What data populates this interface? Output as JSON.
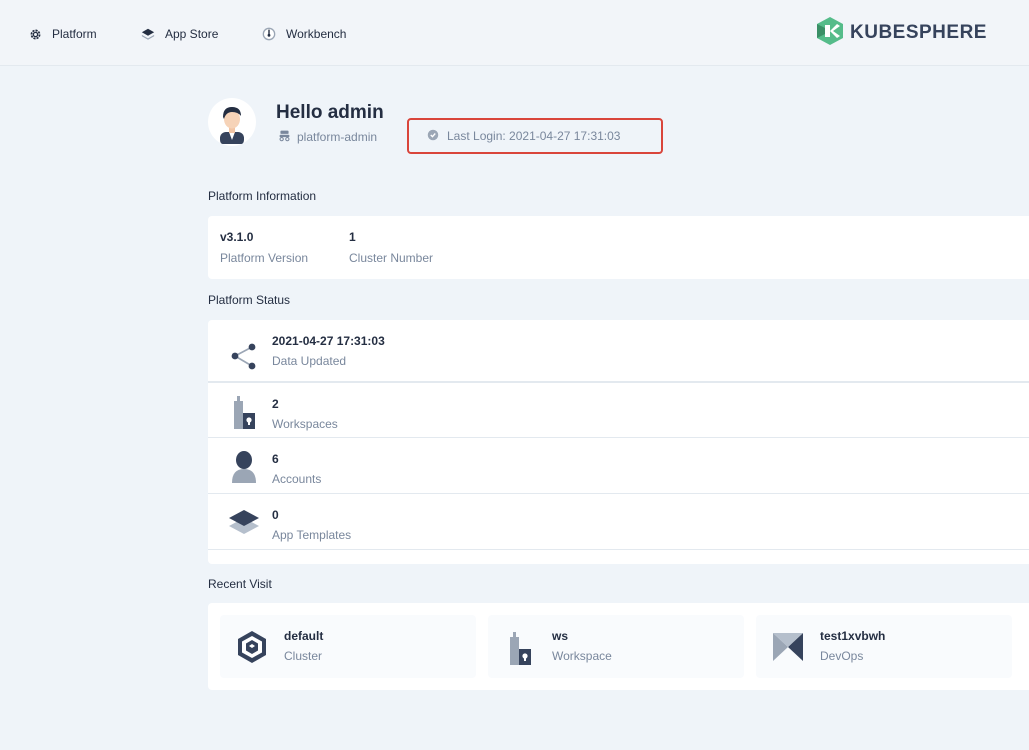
{
  "nav": {
    "items": [
      {
        "label": "Platform",
        "icon": "gear-icon"
      },
      {
        "label": "App Store",
        "icon": "layers-icon"
      },
      {
        "label": "Workbench",
        "icon": "dashboard-icon"
      }
    ],
    "brand": "KUBESPHERE"
  },
  "header": {
    "greeting": "Hello admin",
    "role": "platform-admin",
    "last_login": "Last Login: 2021-04-27 17:31:03"
  },
  "platform_info": {
    "title": "Platform Information",
    "items": [
      {
        "value": "v3.1.0",
        "label": "Platform Version"
      },
      {
        "value": "1",
        "label": "Cluster Number"
      }
    ]
  },
  "platform_status": {
    "title": "Platform Status",
    "items": [
      {
        "value": "2021-04-27 17:31:03",
        "label": "Data Updated",
        "icon": "share-nodes-icon"
      },
      {
        "value": "2",
        "label": "Workspaces",
        "icon": "workspace-icon"
      },
      {
        "value": "6",
        "label": "Accounts",
        "icon": "user-icon"
      },
      {
        "value": "0",
        "label": "App Templates",
        "icon": "app-templates-icon"
      }
    ]
  },
  "recent_visit": {
    "title": "Recent Visit",
    "items": [
      {
        "name": "default",
        "type": "Cluster",
        "icon": "cluster-icon"
      },
      {
        "name": "ws",
        "type": "Workspace",
        "icon": "workspace-icon"
      },
      {
        "name": "test1xvbwh",
        "type": "DevOps",
        "icon": "devops-icon"
      }
    ]
  },
  "colors": {
    "accent_green": "#55bc8a",
    "highlight_red": "#d9453b",
    "text_primary": "#242e42",
    "text_secondary": "#79879c"
  }
}
